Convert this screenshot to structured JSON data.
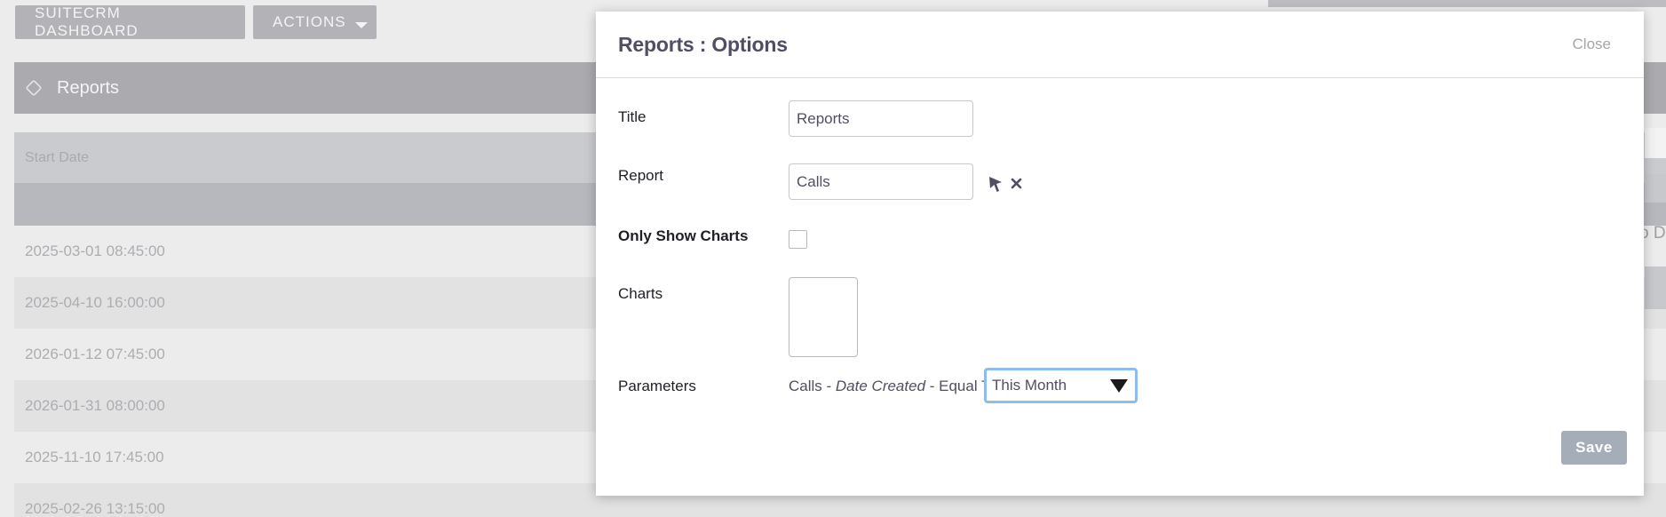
{
  "background": {
    "dashboard_button": "SUITECRM DASHBOARD",
    "actions_button": "ACTIONS",
    "dashlet_title": "Reports",
    "column_header": "Start Date",
    "rows": [
      "2025-03-01 08:45:00",
      "2025-04-10 16:00:00",
      "2026-01-12 07:45:00",
      "2026-01-31 08:00:00",
      "2025-11-10 17:45:00",
      "2025-02-26 13:15:00"
    ],
    "right_fragment": "o D"
  },
  "modal": {
    "title": "Reports : Options",
    "close_label": "Close",
    "fields": {
      "title_label": "Title",
      "title_value": "Reports",
      "report_label": "Report",
      "report_value": "Calls",
      "only_show_charts_label": "Only Show Charts",
      "only_show_charts_checked": false,
      "charts_label": "Charts",
      "parameters_label": "Parameters",
      "parameter_module": "Calls - ",
      "parameter_field": "Date Created",
      "parameter_operator": " - Equal To",
      "parameter_value": "This Month"
    },
    "save_label": "Save"
  },
  "icons": {
    "select_report": "cursor-arrow-icon",
    "clear_report": "close-x-icon",
    "dashlet": "cube-icon",
    "dropdown": "triangle-down-icon"
  }
}
